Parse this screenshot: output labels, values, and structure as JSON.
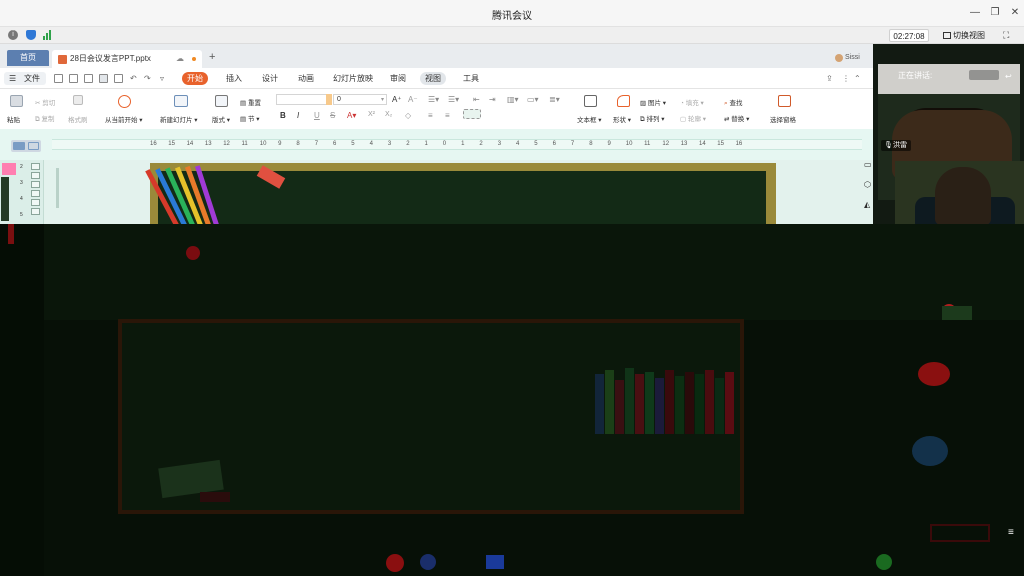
{
  "window": {
    "title": "腾讯会议",
    "minimize_icon": "minimize-icon",
    "restore_icon": "restore-icon",
    "close_icon": "close-icon"
  },
  "meeting_bar": {
    "timer": "02:27:08",
    "switch_view_label": "切换视图",
    "icons": [
      "info-icon",
      "shield-icon",
      "signal-icon",
      "fullscreen-icon"
    ]
  },
  "wps": {
    "home_tab": "首页",
    "doc_tab": "28日会议发言PPT.pptx",
    "new_tab_symbol": "+",
    "user_name": "Sissi",
    "menu": {
      "file": "文件",
      "tabs": [
        "开始",
        "插入",
        "设计",
        "动画",
        "幻灯片放映",
        "审阅",
        "视图",
        "工具"
      ],
      "active_tab": "开始"
    },
    "ribbon": {
      "paste": "粘贴",
      "cut": "剪切",
      "copy": "复制",
      "format_painter": "格式刷",
      "play_from_current": "从当前开始",
      "new_slide": "新建幻灯片",
      "layout": "版式",
      "reset": "重置",
      "section": "节",
      "font_size": "0",
      "text_box": "文本框",
      "shape": "形状",
      "picture": "图片",
      "fill": "填充",
      "arrange": "排列",
      "outline": "轮廓",
      "find": "查找",
      "replace": "替换",
      "select_pane": "选择窗格"
    },
    "ruler_ticks": [
      "16",
      "15",
      "14",
      "13",
      "12",
      "11",
      "10",
      "9",
      "8",
      "7",
      "6",
      "5",
      "4",
      "3",
      "2",
      "1",
      "0",
      "1",
      "2",
      "3",
      "4",
      "5",
      "6",
      "7",
      "8",
      "9",
      "10",
      "11",
      "12",
      "13",
      "14",
      "15",
      "16"
    ],
    "slide_numbers": [
      "2",
      "3",
      "4",
      "5"
    ]
  },
  "video": {
    "speaking_label": "正在讲话:",
    "speaker_name": "洪雷"
  },
  "colors": {
    "accent": "#e8622c",
    "home_tab": "#5c7fb0",
    "board": "#132a16"
  }
}
